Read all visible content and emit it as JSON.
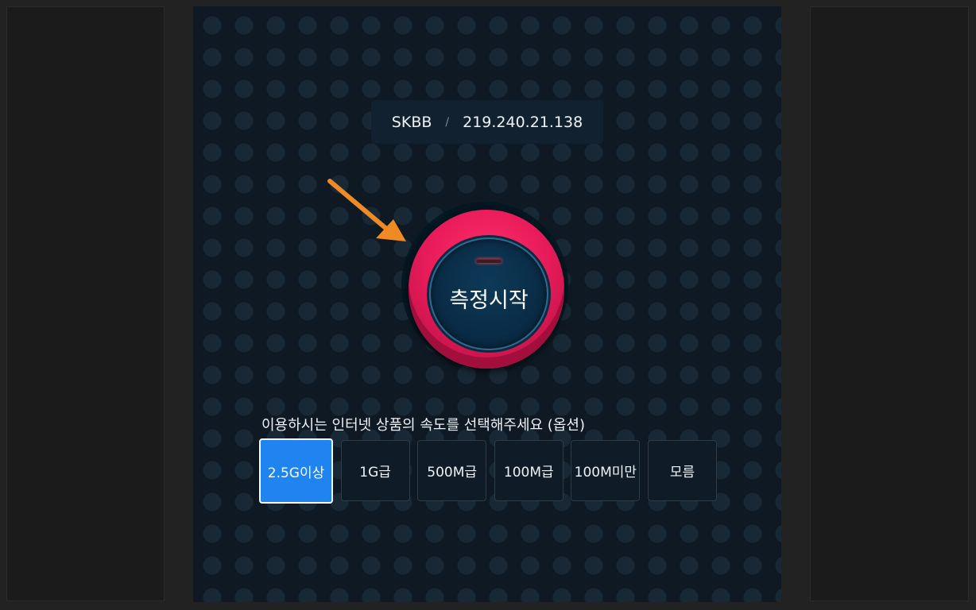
{
  "isp": {
    "name": "SKBB",
    "separator": "/",
    "ip": "219.240.21.138"
  },
  "start_button": {
    "label": "측정시작"
  },
  "speed_selection": {
    "question": "이용하시는 인터넷 상품의 속도를 선택해주세요 (옵션)",
    "selected": "2.5G이상",
    "options": [
      "2.5G이상",
      "1G급",
      "500M급",
      "100M급",
      "100M미만",
      "모름"
    ]
  },
  "colors": {
    "accent_red": "#e91c5b",
    "selected_blue": "#1f84f0",
    "arrow_orange": "#f08a24"
  },
  "icons": {
    "annotation_arrow": "arrow-icon"
  }
}
